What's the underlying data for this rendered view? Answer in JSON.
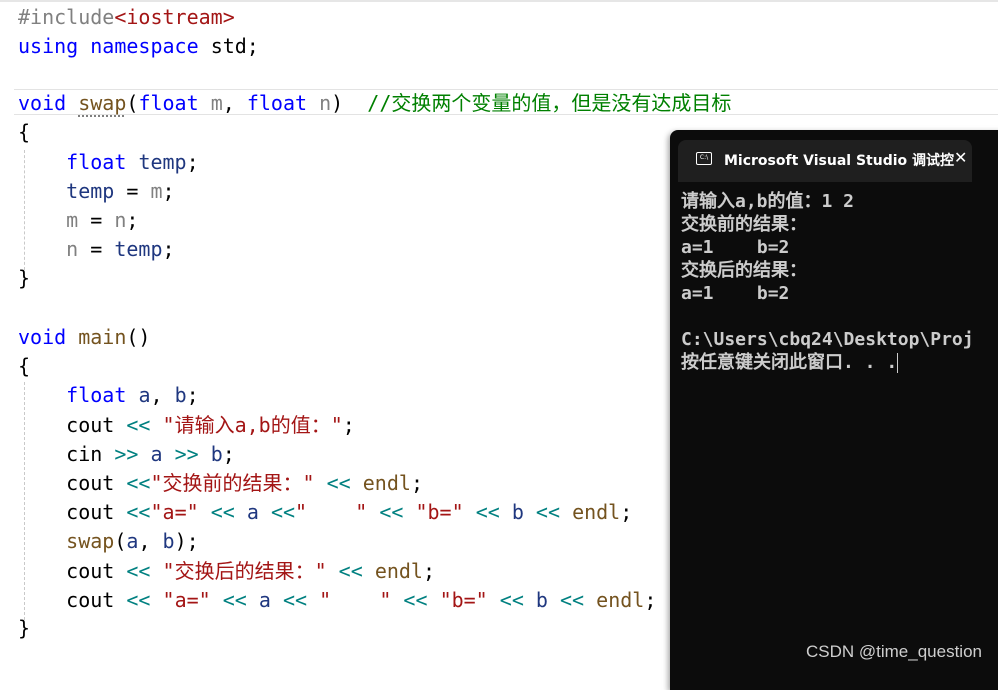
{
  "code": {
    "include_directive": "#include",
    "include_header": "<iostream>",
    "using_kw": "using",
    "namespace_kw": "namespace",
    "namespace_name": "std;",
    "kw_void": "void",
    "kw_float": "float",
    "fn_swap": "swap",
    "fn_main": "main",
    "param_m": "m",
    "param_n": "n",
    "var_temp": "temp",
    "var_a": "a",
    "var_b": "b",
    "cout": "cout",
    "cin": "cin",
    "endl": "endl",
    "op_out": "<<",
    "op_in": ">>",
    "brace_open": "{",
    "brace_close": "}",
    "swap_comment": "//交换两个变量的值，但是没有达成目标",
    "str_prompt": "\"请输入a,b的值：\"",
    "str_before": "\"交换前的结果：\"",
    "str_after": "\"交换后的结果：\"",
    "str_a_eq": "\"a=\"",
    "str_spaces": "\"    \"",
    "str_b_eq": "\"b=\""
  },
  "console": {
    "title": "Microsoft Visual Studio 调试控",
    "icon": "console-icon",
    "close_glyph": "✕",
    "lines": [
      "请输入a,b的值：1 2",
      "交换前的结果：",
      "a=1    b=2",
      "交换后的结果：",
      "a=1    b=2",
      "",
      "C:\\Users\\cbq24\\Desktop\\Proj",
      "按任意键关闭此窗口. . ."
    ]
  },
  "watermark": "CSDN @time_question"
}
